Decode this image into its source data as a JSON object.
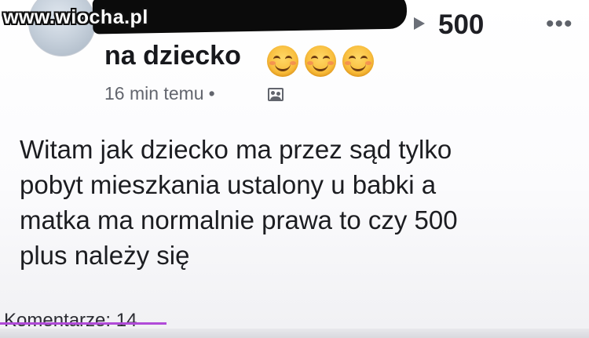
{
  "watermark": "www.wiocha.pl",
  "post": {
    "title_amount": "500",
    "title_line2": "na dziecko",
    "title_emojis": [
      "smiling-face-icon",
      "smiling-face-icon",
      "smiling-face-icon"
    ],
    "timestamp": "16 min temu",
    "separator": "•",
    "audience_icon": "group-icon",
    "more_icon": "•••",
    "body_lines": [
      "Witam jak dziecko ma przez sąd tylko",
      "pobyt mieszkania ustalony u babki a",
      "matka ma normalnie prawa to czy 500",
      "plus należy się"
    ],
    "comments_label": "Komentarze: 14"
  },
  "colors": {
    "accent_underline": "#b04ad8",
    "emoji": "#f7b733",
    "text": "#1c1d21",
    "muted": "#62656d"
  }
}
